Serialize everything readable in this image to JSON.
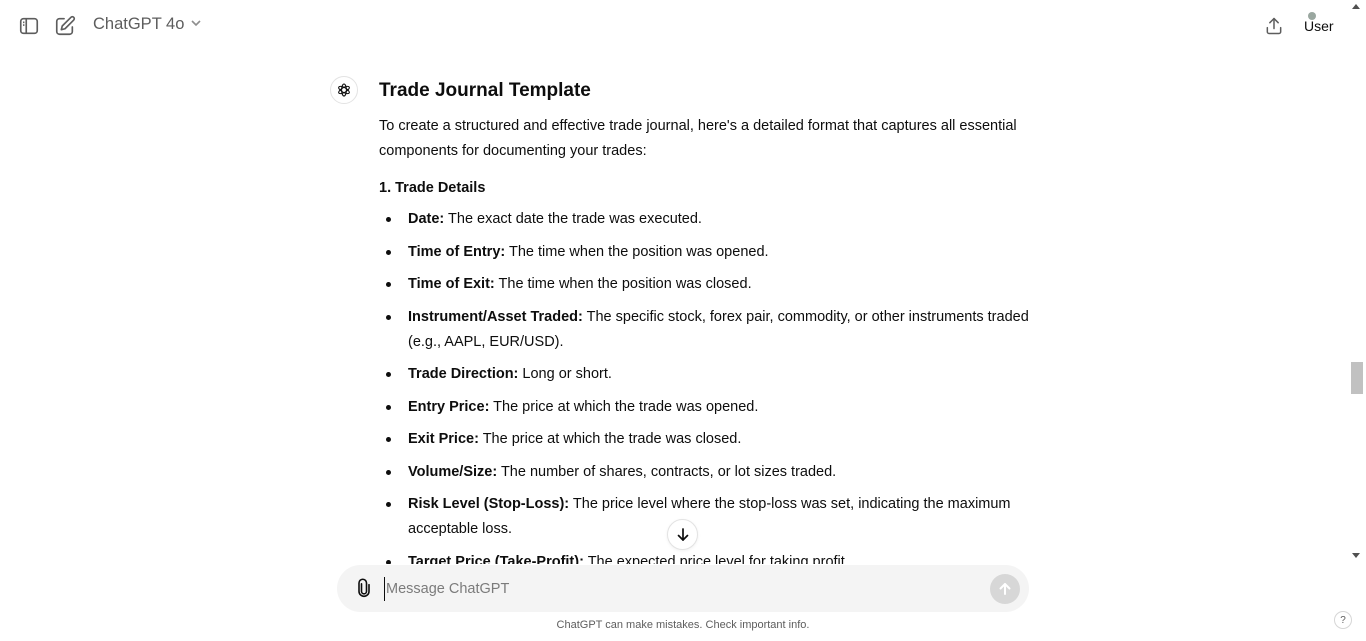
{
  "header": {
    "model_name": "ChatGPT 4o",
    "user_label": "User",
    "icons": {
      "sidebar": "sidebar-toggle-icon",
      "new_chat": "new-chat-icon",
      "share": "share-icon",
      "dropdown": "chevron-down-icon"
    }
  },
  "message": {
    "heading": "Trade Journal Template",
    "intro": "To create a structured and effective trade journal, here's a detailed format that captures all essential components for documenting your trades:",
    "section_title": "1. Trade Details",
    "items": [
      {
        "label": "Date:",
        "text": " The exact date the trade was executed."
      },
      {
        "label": "Time of Entry:",
        "text": " The time when the position was opened."
      },
      {
        "label": "Time of Exit:",
        "text": " The time when the position was closed."
      },
      {
        "label": "Instrument/Asset Traded:",
        "text": " The specific stock, forex pair, commodity, or other instruments traded (e.g., AAPL, EUR/USD)."
      },
      {
        "label": "Trade Direction:",
        "text": " Long or short."
      },
      {
        "label": "Entry Price:",
        "text": " The price at which the trade was opened."
      },
      {
        "label": "Exit Price:",
        "text": " The price at which the trade was closed."
      },
      {
        "label": "Volume/Size:",
        "text": " The number of shares, contracts, or lot sizes traded."
      },
      {
        "label": "Risk Level (Stop-Loss):",
        "text": " The price level where the stop-loss was set, indicating the maximum acceptable loss."
      },
      {
        "label": "Target Price (Take-Profit):",
        "text": " The expected price level for taking profit."
      }
    ]
  },
  "composer": {
    "placeholder": "Message ChatGPT"
  },
  "footer": {
    "disclaimer": "ChatGPT can make mistakes. Check important info.",
    "help_label": "?"
  },
  "colors": {
    "text": "#0d0d0d",
    "muted": "#5d5d5d",
    "composer_bg": "#f4f4f4",
    "send_disabled": "#d7d7d7"
  }
}
